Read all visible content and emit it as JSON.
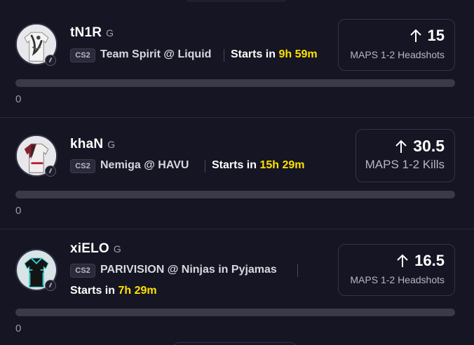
{
  "cards": [
    {
      "player": "tN1R",
      "position": "G",
      "game": "CS2",
      "matchup": "Team Spirit @ Liquid",
      "starts_label": "Starts in",
      "starts_time": "9h 59m",
      "line": "15",
      "direction_icon": "arrow-up-icon",
      "stat": "MAPS 1-2 Headshots",
      "progress_count": "0",
      "progress_fraction": 0
    },
    {
      "player": "khaN",
      "position": "G",
      "game": "CS2",
      "matchup": "Nemiga @ HAVU",
      "starts_label": "Starts in",
      "starts_time": "15h 29m",
      "line": "30.5",
      "direction_icon": "arrow-up-icon",
      "stat": "MAPS 1-2 Kills",
      "progress_count": "0",
      "progress_fraction": 0
    },
    {
      "player": "xiELO",
      "position": "G",
      "game": "CS2",
      "matchup": "PARIVISION @ Ninjas in Pyjamas",
      "starts_label": "Starts in",
      "starts_time": "7h 29m",
      "line": "16.5",
      "direction_icon": "arrow-up-icon",
      "stat": "MAPS 1-2 Headshots",
      "progress_count": "0",
      "progress_fraction": 0
    }
  ],
  "colors": {
    "background": "#151523",
    "accent_time": "#ffe100",
    "progress_track": "#3a3a4a"
  }
}
